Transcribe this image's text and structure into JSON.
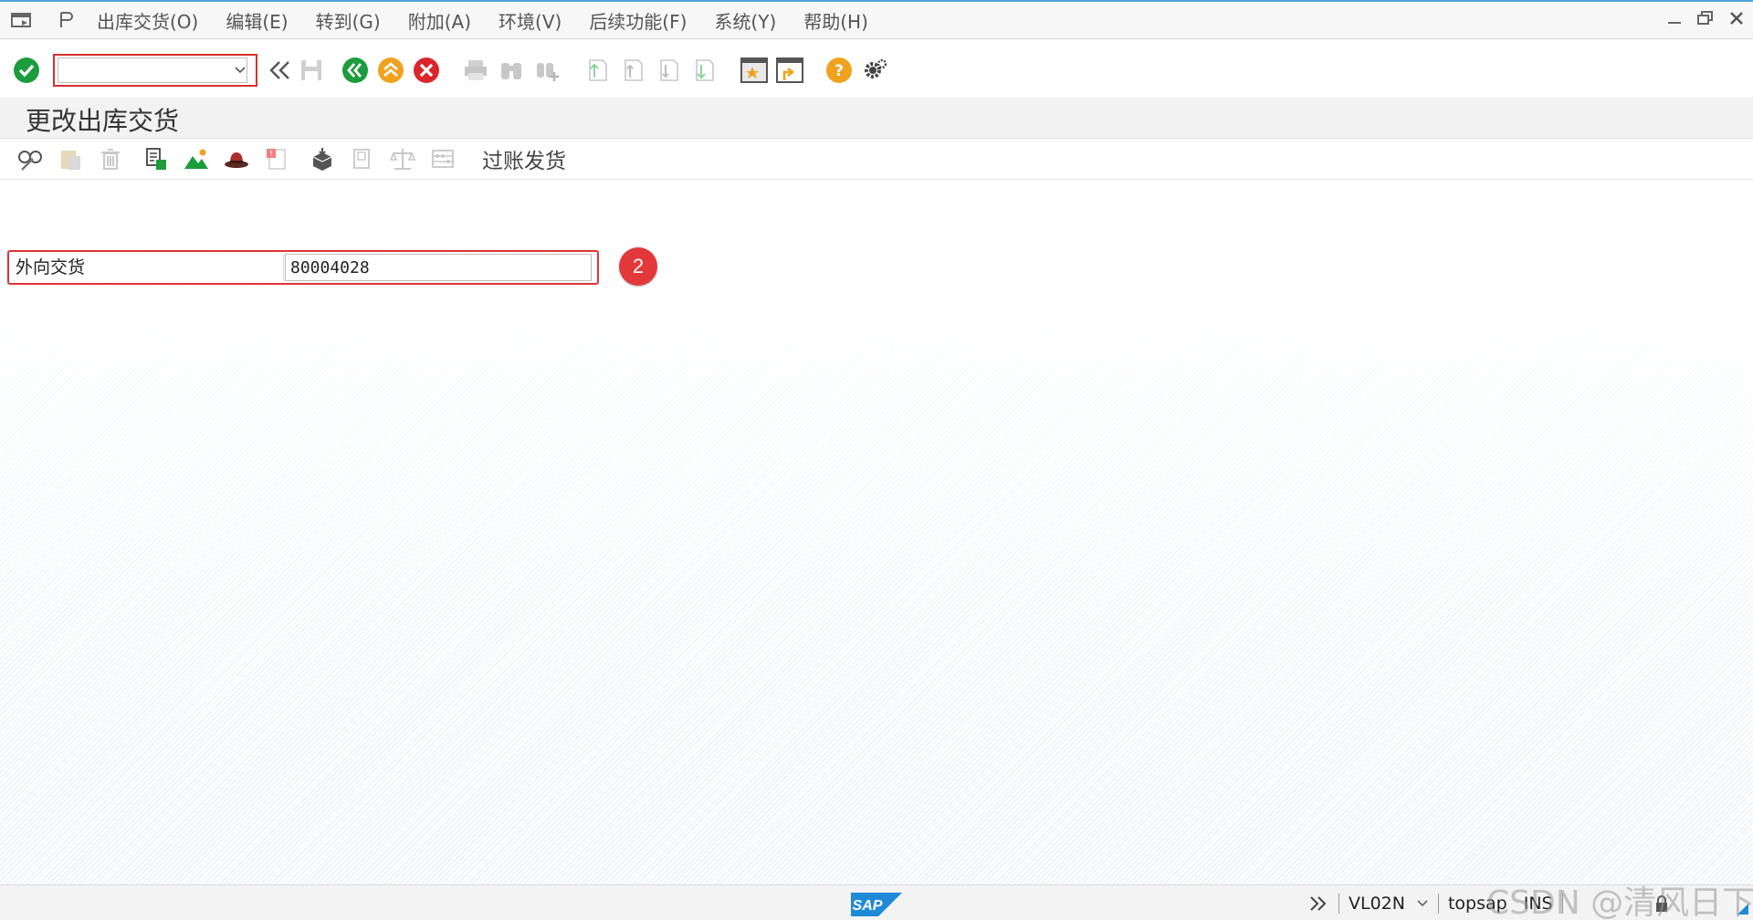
{
  "menubar": {
    "items": [
      "出库交货(O)",
      "编辑(E)",
      "转到(G)",
      "附加(A)",
      "环境(V)",
      "后续功能(F)",
      "系统(Y)",
      "帮助(H)"
    ]
  },
  "toolbar": {
    "command_value": "",
    "icons": [
      "enter-icon",
      "back-arrows-icon",
      "save-icon",
      "back-icon",
      "exit-icon",
      "cancel-icon",
      "print-icon",
      "find-icon",
      "find-next-icon",
      "first-page-icon",
      "previous-page-icon",
      "next-page-icon",
      "last-page-icon",
      "create-session-icon",
      "create-shortcut-icon",
      "help-icon",
      "settings-icon"
    ]
  },
  "title": "更改出库交货",
  "apptoolbar": {
    "post_goods_issue": "过账发货"
  },
  "form": {
    "outbound_delivery_label": "外向交货",
    "outbound_delivery_value": "80004028",
    "step_badge": "2"
  },
  "statusbar": {
    "transaction": "VL02N",
    "server": "topsap",
    "mode": "INS",
    "logo_text": "SAP"
  },
  "watermark": "CSDN @清风日下",
  "colors": {
    "accent_red": "#e2383a",
    "green": "#1c9c3c",
    "orange": "#f0a21f",
    "sap_blue": "#1f8ad8"
  }
}
